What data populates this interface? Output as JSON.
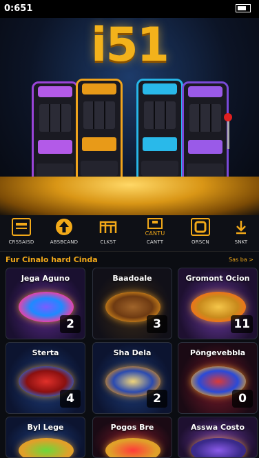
{
  "status_bar": {
    "time": "0:651"
  },
  "hero": {
    "logo_text": "i51"
  },
  "nav": {
    "items": [
      {
        "label": "CRSSAISD",
        "icon": "wallet-icon"
      },
      {
        "label": "ABSBCAND",
        "icon": "arrow-up-icon"
      },
      {
        "label": "CLKST",
        "icon": "building-icon"
      },
      {
        "label": "CANTT",
        "icon": "gift-box-icon",
        "icon_text": "CANTU"
      },
      {
        "label": "ORSCN",
        "icon": "square-frame-icon"
      },
      {
        "label": "SNKT",
        "icon": "download-icon"
      }
    ]
  },
  "section": {
    "title": "Fur Cinalo  hard Cinda",
    "see_all": "Sas ba >"
  },
  "games": [
    {
      "title": "Jega Aguno",
      "badge": "2"
    },
    {
      "title": "Baadoale",
      "badge": "3"
    },
    {
      "title": "Gromont Ocion",
      "badge": "11"
    },
    {
      "title": "Sterta",
      "badge": "4"
    },
    {
      "title": "Sha Dela",
      "badge": "2"
    },
    {
      "title": "Pöngevebbla",
      "badge": "0"
    },
    {
      "title": "Byl Lege",
      "badge": ""
    },
    {
      "title": "Pogos Bre",
      "badge": ""
    },
    {
      "title": "Asswa Costo",
      "badge": ""
    }
  ],
  "colors": {
    "accent": "#f2a919",
    "background": "#0b0d12"
  }
}
